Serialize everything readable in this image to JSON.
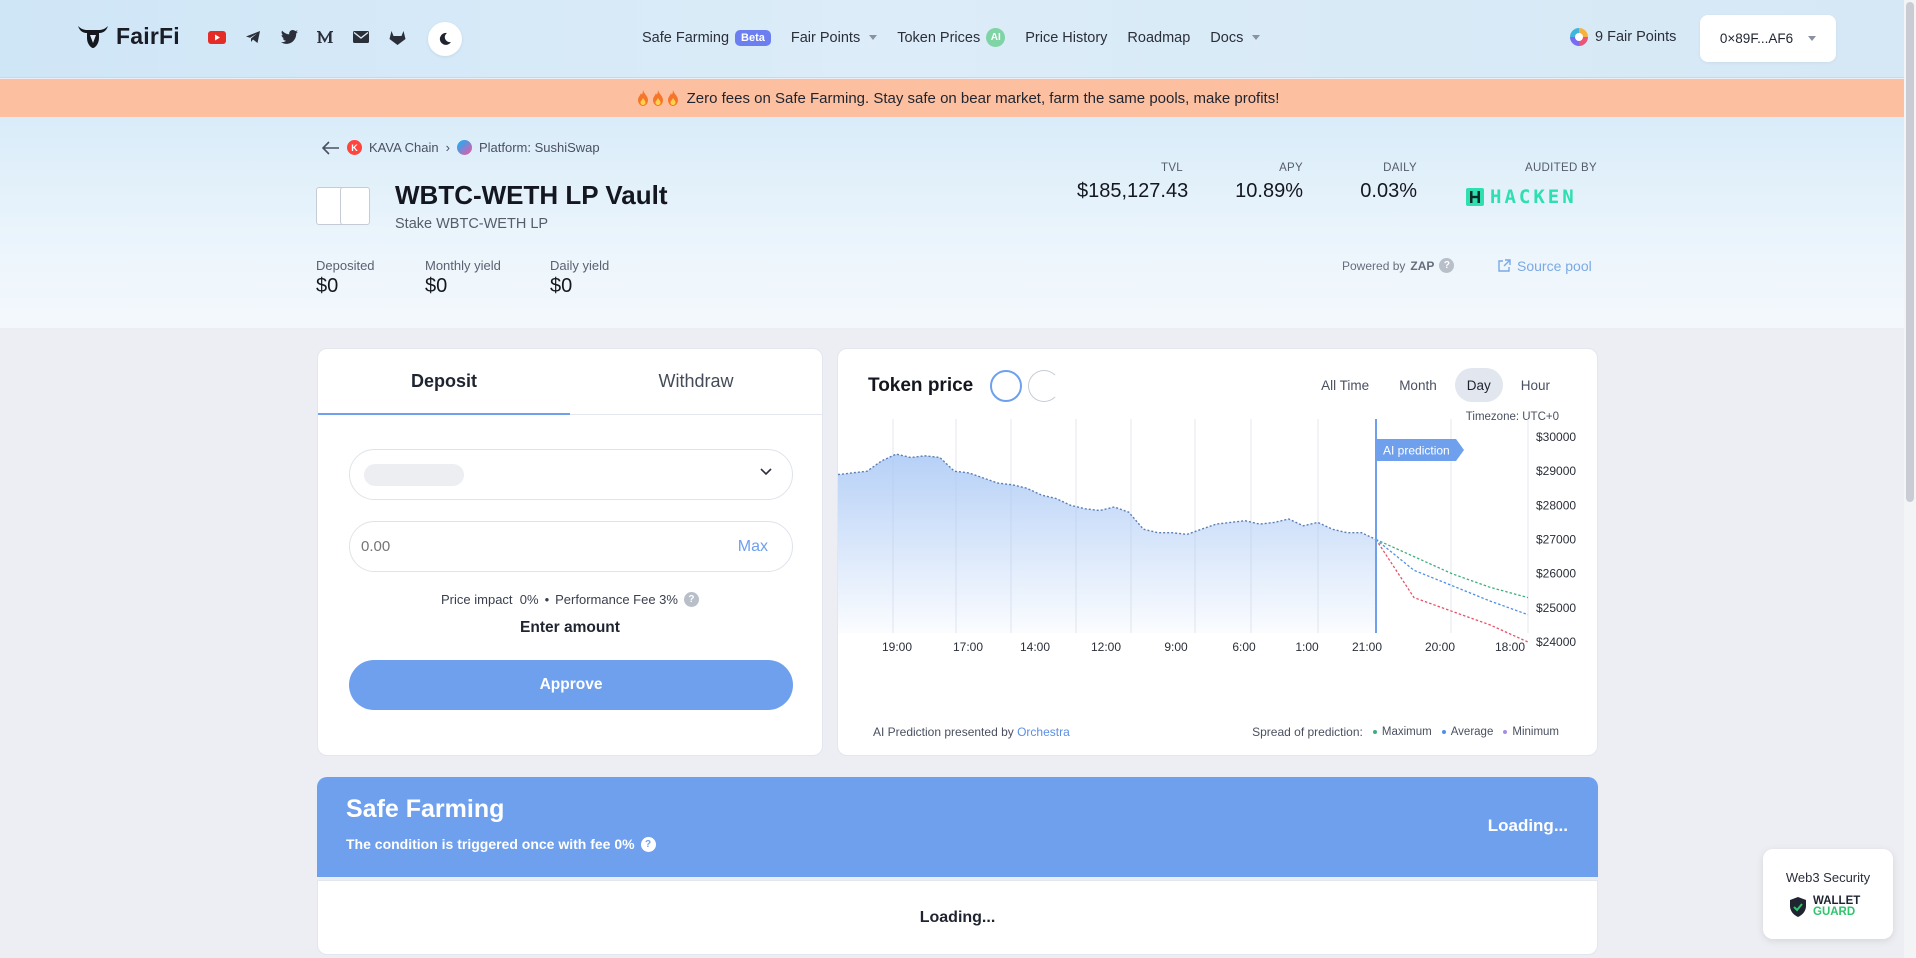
{
  "header": {
    "logo_text": "FairFi",
    "socials": [
      "youtube-icon",
      "telegram-icon",
      "twitter-icon",
      "medium-icon",
      "mail-icon",
      "gitlab-icon"
    ],
    "nav": {
      "safe_farming": "Safe Farming",
      "safe_farming_badge": "Beta",
      "fair_points": "Fair Points",
      "token_prices": "Token Prices",
      "token_prices_badge": "AI",
      "price_history": "Price History",
      "roadmap": "Roadmap",
      "docs": "Docs"
    },
    "fair_points_label": "9 Fair Points",
    "wallet_address": "0×89F...AF6"
  },
  "banner": {
    "text": "Zero fees on Safe Farming. Stay safe on bear market, farm the same pools, make profits!"
  },
  "breadcrumb": {
    "chain": "KAVA Chain",
    "chain_letter": "K",
    "platform": "Platform: SushiSwap"
  },
  "vault": {
    "title": "WBTC-WETH LP Vault",
    "subtitle": "Stake WBTC-WETH LP"
  },
  "stats": {
    "tvl_label": "TVL",
    "tvl_value": "$185,127.43",
    "apy_label": "APY",
    "apy_value": "10.89%",
    "daily_label": "DAILY",
    "daily_value": "0.03%",
    "audited_label": "AUDITED BY",
    "auditor": "HACKEN"
  },
  "user_stats": {
    "deposited_label": "Deposited",
    "deposited_value": "$0",
    "monthly_label": "Monthly yield",
    "monthly_value": "$0",
    "daily_label": "Daily yield",
    "daily_value": "$0"
  },
  "powered": {
    "prefix": "Powered by",
    "brand": "ZAP",
    "source_pool": "Source pool"
  },
  "deposit": {
    "tab_deposit": "Deposit",
    "tab_withdraw": "Withdraw",
    "amount_placeholder": "0.00",
    "max_label": "Max",
    "price_impact": "Price impact  0%",
    "performance_fee": "Performance Fee 3%",
    "enter_amount": "Enter amount",
    "approve": "Approve"
  },
  "chart": {
    "title": "Token price",
    "periods": [
      "All Time",
      "Month",
      "Day",
      "Hour"
    ],
    "active_period": "Day",
    "timezone": "Timezone: UTC+0",
    "prediction_tag": "AI prediction",
    "footer_prefix": "AI Prediction presented by",
    "footer_brand": "Orchestra",
    "spread_label": "Spread of prediction:",
    "legend_max": "Maximum",
    "legend_avg": "Average",
    "legend_min": "Minimum"
  },
  "chart_data": {
    "type": "area",
    "x_ticks": [
      "19:00",
      "17:00",
      "14:00",
      "12:00",
      "9:00",
      "6:00",
      "1:00",
      "21:00",
      "20:00",
      "18:00"
    ],
    "y_ticks": [
      "$30000",
      "$29000",
      "$28000",
      "$27000",
      "$26000",
      "$25000",
      "$24000"
    ],
    "ylim": [
      24000,
      30000
    ],
    "history": [
      28900,
      28950,
      29000,
      29300,
      29500,
      29400,
      29450,
      29400,
      29000,
      28950,
      28800,
      28650,
      28600,
      28500,
      28300,
      28200,
      28000,
      27900,
      27850,
      27950,
      27800,
      27300,
      27200,
      27200,
      27150,
      27300,
      27450,
      27500,
      27550,
      27450,
      27500,
      27600,
      27400,
      27500,
      27300,
      27200,
      27200,
      27000
    ],
    "prediction": {
      "max": [
        27000,
        26500,
        26000,
        25600,
        25300
      ],
      "avg": [
        27000,
        26100,
        25650,
        25200,
        24800
      ],
      "min": [
        27000,
        25300,
        24900,
        24500,
        24000
      ]
    },
    "colors": {
      "area": "#a9c8f5",
      "line": "#5b7fb5",
      "max": "#3fae7d",
      "avg": "#4f8fe8",
      "min": "#e6526a",
      "divider": "#6ea0ee"
    },
    "grid": true
  },
  "safe_farming": {
    "title": "Safe Farming",
    "subtitle": "The condition is triggered once with fee 0%",
    "status": "Loading...",
    "body_status": "Loading..."
  },
  "wallet_guard": {
    "label": "Web3 Security",
    "word1": "WALLET",
    "word2": "GUARD"
  }
}
